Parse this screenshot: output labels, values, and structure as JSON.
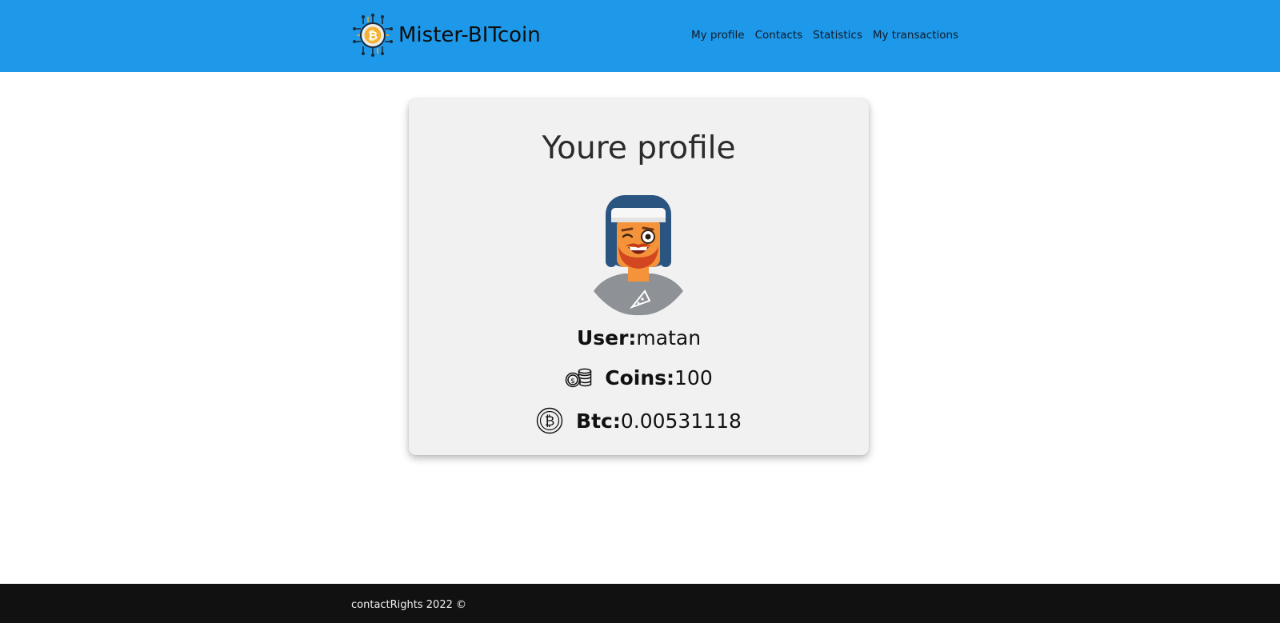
{
  "header": {
    "brand": "Mister-BITcoin",
    "bg_color": "#1e98e8",
    "logo_icon": "bitcoin-circuit-icon",
    "nav": [
      {
        "label": "My profile"
      },
      {
        "label": "Contacts"
      },
      {
        "label": "Statistics"
      },
      {
        "label": "My transactions"
      }
    ]
  },
  "profile": {
    "title": "Youre profile",
    "avatar_icon": "winking-man-avatar",
    "user_label": "User:",
    "user_value": "matan",
    "coins_icon": "coins-stack-icon",
    "coins_label": "Coins:",
    "coins_value": "100",
    "btc_icon": "bitcoin-icon",
    "btc_label": "Btc:",
    "btc_value": "0.00531118"
  },
  "footer": {
    "text": "contactRights 2022 ©",
    "bg_color": "#111111"
  }
}
